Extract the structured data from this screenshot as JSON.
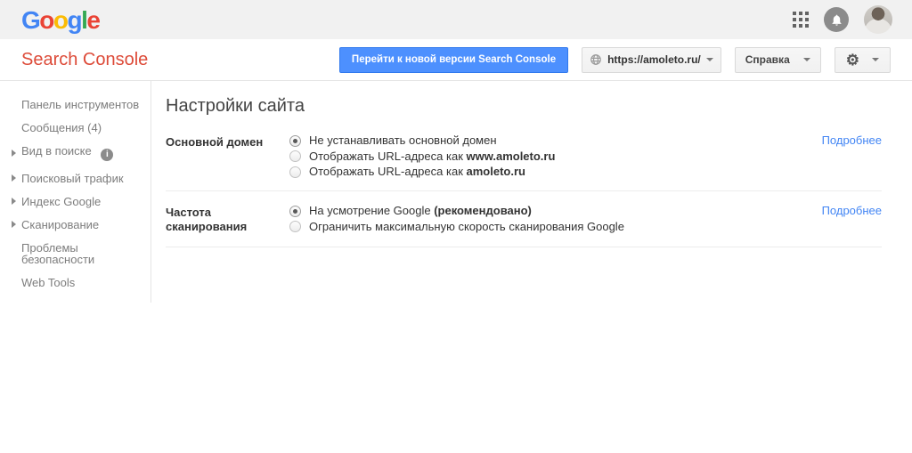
{
  "topbar": {
    "logo_letters": [
      {
        "ch": "G",
        "color": "#4285F4"
      },
      {
        "ch": "o",
        "color": "#EA4335"
      },
      {
        "ch": "o",
        "color": "#FBBC05"
      },
      {
        "ch": "g",
        "color": "#4285F4"
      },
      {
        "ch": "l",
        "color": "#34A853"
      },
      {
        "ch": "e",
        "color": "#EA4335"
      }
    ]
  },
  "header": {
    "app_title": "Search Console",
    "new_version_button_label": "Перейти к новой версии Search Console",
    "property_selector_value": "https://amoleto.ru/",
    "help_button_label": "Справка"
  },
  "icons": {
    "gear_glyph": "⚙",
    "info_glyph": "i"
  },
  "sidebar": {
    "items": [
      {
        "label": "Панель инструментов",
        "expandable": false
      },
      {
        "label": "Сообщения (4)",
        "expandable": false
      },
      {
        "label": "Вид в поиске",
        "expandable": true,
        "has_info_icon": true
      },
      {
        "label": "Поисковый трафик",
        "expandable": true
      },
      {
        "label": "Индекс Google",
        "expandable": true
      },
      {
        "label": "Сканирование",
        "expandable": true
      },
      {
        "label": "Проблемы безопасности",
        "expandable": false
      },
      {
        "label": "Web Tools",
        "expandable": false
      }
    ]
  },
  "main": {
    "title": "Настройки сайта",
    "sections": [
      {
        "label": "Основной домен",
        "more_link": "Подробнее",
        "options": [
          {
            "text": "Не устанавливать основной домен",
            "bold": "",
            "selected": true
          },
          {
            "text": "Отображать URL-адреса как ",
            "bold": "www.amoleto.ru",
            "selected": false
          },
          {
            "text": "Отображать URL-адреса как ",
            "bold": "amoleto.ru",
            "selected": false
          }
        ]
      },
      {
        "label": "Частота сканирования",
        "more_link": "Подробнее",
        "options": [
          {
            "text": "На усмотрение Google ",
            "bold": "(рекомендовано)",
            "selected": true
          },
          {
            "text": "Ограничить максимальную скорость сканирования Google",
            "bold": "",
            "selected": false
          }
        ]
      }
    ]
  },
  "colors": {
    "topbar_bg": "#f1f1f1",
    "app_title_red": "#dd4b39",
    "primary_button_blue": "#4d90fe",
    "link_blue": "#4285f4",
    "sidebar_text": "#7d7d7d",
    "body_text": "#333333",
    "divider": "#e5e5e5"
  }
}
